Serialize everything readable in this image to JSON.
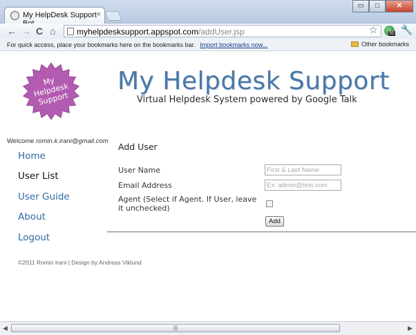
{
  "browser": {
    "tab_title": "My HelpDesk Support Bot",
    "tab_close": "×",
    "url_host": "myhelpdesksupport.appspot.com",
    "url_path": "/addUser.jsp",
    "window_buttons": {
      "minimize": "▭",
      "maximize": "□",
      "close": "✕"
    },
    "nav_icons": {
      "back": "←",
      "forward": "→",
      "reload": "C",
      "home": "⌂"
    },
    "extension_badge": "50",
    "bookmarks_bar": {
      "prompt": "For quick access, place your bookmarks here on the bookmarks bar.",
      "import_link": "Import bookmarks now...",
      "other_bookmarks": "Other bookmarks"
    }
  },
  "site": {
    "logo_lines": [
      "My",
      "Helpdesk",
      "Support"
    ],
    "title": "My Helpdesk Support",
    "tagline": "Virtual Helpdesk System powered by Google Talk",
    "logo_color": "#b25bb0",
    "title_color": "#4a78a8"
  },
  "sidebar": {
    "welcome_label": "Welcome",
    "user_email": "romin.k.irani@gmail.com",
    "nav": [
      {
        "label": "Home",
        "active": false
      },
      {
        "label": "User List",
        "active": true
      },
      {
        "label": "User Guide",
        "active": false
      },
      {
        "label": "About",
        "active": false
      },
      {
        "label": "Logout",
        "active": false
      }
    ]
  },
  "form": {
    "heading": "Add User",
    "fields": {
      "username": {
        "label": "User Name",
        "placeholder": "First & Last Name",
        "value": ""
      },
      "email": {
        "label": "Email Address",
        "placeholder": "Ex: admin@test.com",
        "value": ""
      },
      "agent": {
        "label": "Agent (Select if Agent. If User, leave it unchecked)",
        "checked": false
      }
    },
    "submit_label": "Add"
  },
  "footer": {
    "text": "©2011 Romin Irani | Design by Andreas Viklund"
  },
  "scrollbar": {
    "left_arrow": "◀",
    "right_arrow": "▶",
    "grip": "|||"
  }
}
